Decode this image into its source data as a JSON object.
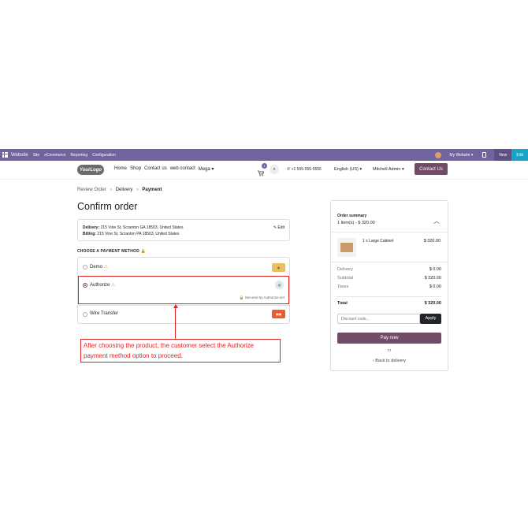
{
  "adminbar": {
    "brand": "Website",
    "menu": [
      "Site",
      "eCommerce",
      "Reporting",
      "Configuration"
    ],
    "site_selector": "My Website",
    "new_label": "New",
    "edit_label": "Edit"
  },
  "header": {
    "logo_text": "YourLogo",
    "nav": [
      "Home",
      "Shop",
      "Contact us",
      "web contact",
      "Mega"
    ],
    "cart_count": "1",
    "phone": "+1 555-555-5556",
    "language": "English (US)",
    "user": "Mitchell Admin",
    "contact_button": "Contact Us"
  },
  "breadcrumb": {
    "step1": "Review Order",
    "step2": "Delivery",
    "step3": "Payment"
  },
  "page_title": "Confirm order",
  "address": {
    "delivery_label": "Delivery:",
    "delivery_value": "215 Vine St, Scranton GA 18503, United States",
    "billing_label": "Billing:",
    "billing_value": "215 Vine St, Scranton PA 18503, United States",
    "edit": "Edit"
  },
  "payment": {
    "title": "CHOOSE A PAYMENT METHOD",
    "methods": [
      {
        "label": "Demo",
        "selected": false
      },
      {
        "label": "Authorize",
        "selected": true,
        "secured": "Secured by Authorize.net"
      },
      {
        "label": "Wire Transfer",
        "selected": false
      }
    ]
  },
  "annotation": {
    "text": "After choosing the product, the customer select the Authorize payment method option to proceed."
  },
  "summary": {
    "title": "Order summary",
    "subtitle": "1 item(s) -  $ 320.00",
    "product_name": "1 x Large Cabinet",
    "product_price": "$ 320.00",
    "rows": [
      {
        "label": "Delivery",
        "value": "$ 0.00"
      },
      {
        "label": "Subtotal",
        "value": "$ 320.00"
      },
      {
        "label": "Taxes",
        "value": "$ 0.00"
      }
    ],
    "total_label": "Total",
    "total_value": "$ 320.00",
    "discount_placeholder": "Discount code...",
    "apply": "Apply",
    "pay_now": "Pay now",
    "or": "or",
    "back": "Back to delivery"
  },
  "colors": {
    "adminbar": "#71639e",
    "primary": "#714b67",
    "annotation": "#e32222"
  }
}
